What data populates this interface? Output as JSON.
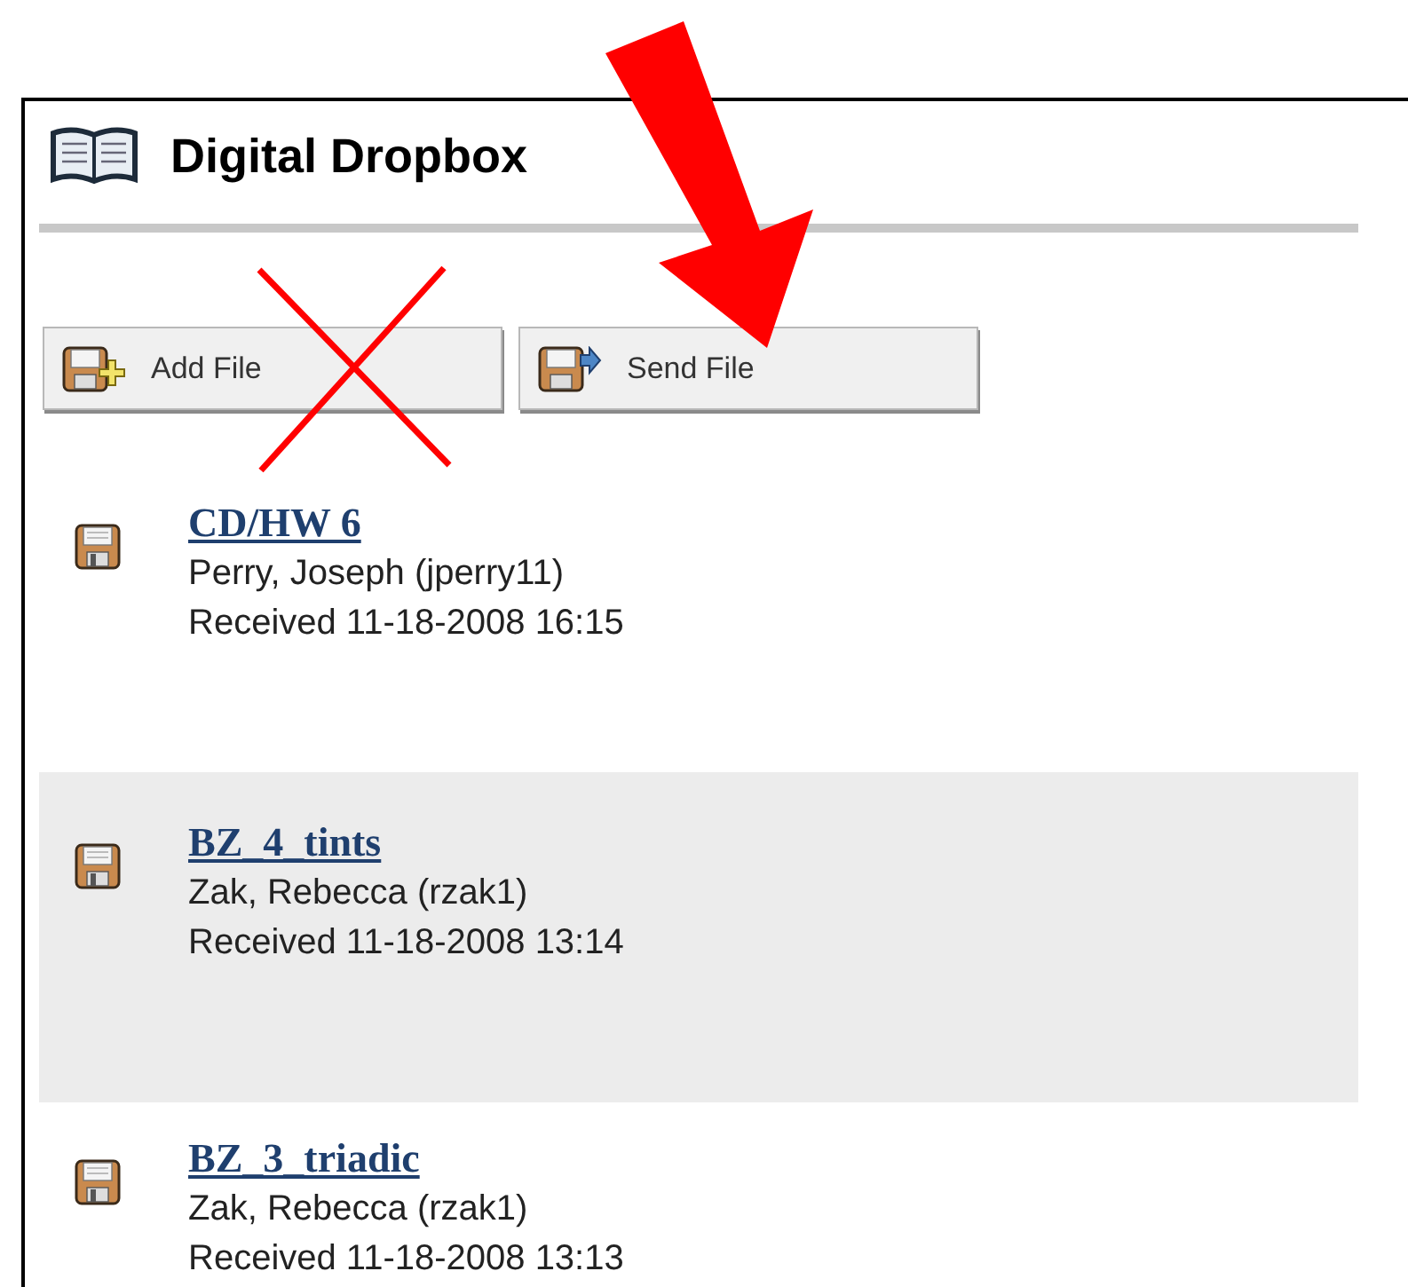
{
  "page": {
    "title": "Digital Dropbox"
  },
  "buttons": [
    {
      "kind": "add",
      "label": "Add File"
    },
    {
      "kind": "send",
      "label": "Send File"
    }
  ],
  "files": [
    {
      "name": "CD/HW 6",
      "sender": "Perry, Joseph (jperry11)",
      "received": "Received 11-18-2008 16:15"
    },
    {
      "name": "BZ_4_tints",
      "sender": "Zak, Rebecca (rzak1)",
      "received": "Received 11-18-2008 13:14"
    },
    {
      "name": "BZ_3_triadic",
      "sender": "Zak, Rebecca (rzak1)",
      "received": "Received 11-18-2008 13:13"
    }
  ]
}
